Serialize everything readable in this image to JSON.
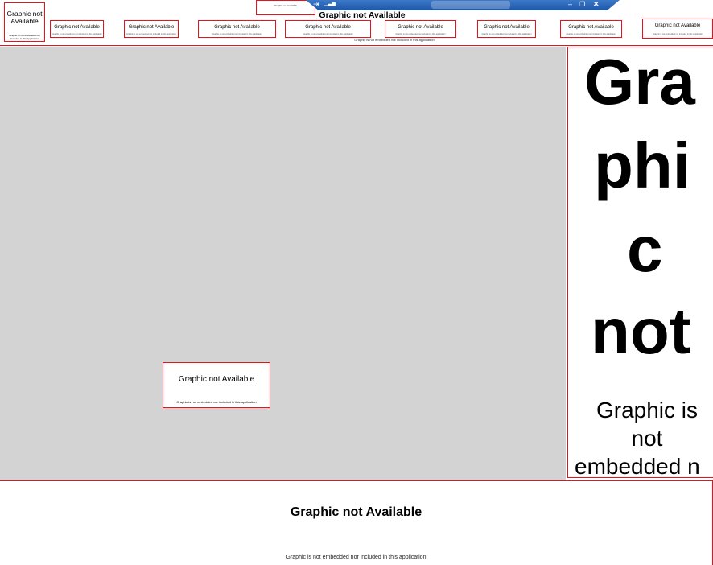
{
  "placeholder": {
    "title": "Graphic not Available",
    "title_split_1": "Graphic not",
    "title_split_2": "Available",
    "subtitle": "Graphic is not embedded nor included in this application",
    "subtitle_short": "Graphic is not embedded nor included in this application",
    "subtitle_trunc": "Graphic is not embedded nor included in this applicatio",
    "big_word_1": "Gra",
    "big_word_2": "phi",
    "big_word_3": "c",
    "big_word_4": "not",
    "big_sub_1": "Graphic is",
    "big_sub_2": "not",
    "big_sub_3": "embedded n"
  },
  "titlebar": {
    "pin_glyph": "⇥",
    "signal_glyph": "▁▃▅",
    "minimize_glyph": "–",
    "restore_glyph": "❐",
    "close_glyph": "✕"
  },
  "colors": {
    "placeholder_border": "#e8121c",
    "canvas_bg": "#d3d3d3",
    "titlebar": "#2a63b4"
  },
  "icons": [
    "pin-icon",
    "signal-icon",
    "minimize-icon",
    "restore-icon",
    "close-icon"
  ]
}
